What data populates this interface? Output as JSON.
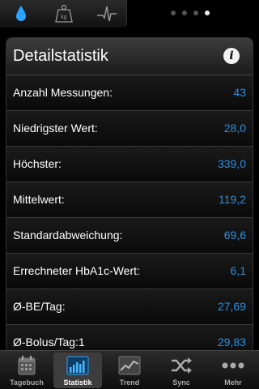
{
  "topbar": {
    "modes": [
      {
        "icon": "blood-drop-icon",
        "selected": true
      },
      {
        "icon": "weight-kg-icon",
        "label": "kg"
      },
      {
        "icon": "heart-pulse-icon"
      }
    ],
    "page_count": 4,
    "current_page": 4
  },
  "panel": {
    "title": "Detailstatistik",
    "info_icon": "info-icon",
    "info_glyph": "i",
    "rows": [
      {
        "label": "Anzahl Messungen:",
        "value": "43"
      },
      {
        "label": "Niedrigster Wert:",
        "value": "28,0"
      },
      {
        "label": "Höchster:",
        "value": "339,0"
      },
      {
        "label": "Mittelwert:",
        "value": "119,2"
      },
      {
        "label": "Standardabweichung:",
        "value": "69,6"
      },
      {
        "label": "Errechneter HbA1c-Wert:",
        "value": "6,1"
      },
      {
        "label": "Ø-BE/Tag:",
        "value": "27,69"
      },
      {
        "label": "Ø-Bolus/Tag:1",
        "value": "29,83"
      }
    ]
  },
  "colors": {
    "value_blue": "#2e8fe0",
    "accent_drop": "#2aa5ff"
  },
  "tabbar": {
    "tabs": [
      {
        "label": "Tagebuch",
        "icon": "calendar-icon",
        "active": false
      },
      {
        "label": "Statistik",
        "icon": "bar-chart-icon",
        "active": true
      },
      {
        "label": "Trend",
        "icon": "trend-line-icon",
        "active": false
      },
      {
        "label": "Sync",
        "icon": "shuffle-icon",
        "active": false
      },
      {
        "label": "Mehr",
        "icon": "more-dots-icon",
        "active": false
      }
    ]
  }
}
